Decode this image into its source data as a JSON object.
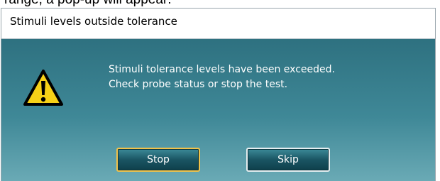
{
  "caption": "range, a pop-up will appear:",
  "dialog": {
    "title": "Stimuli levels outside tolerance",
    "icon": "warning-icon",
    "message_line1": "Stimuli tolerance levels have been exceeded.",
    "message_line2": "Check probe status or stop the test.",
    "buttons": {
      "stop_label": "Stop",
      "skip_label": "Skip"
    }
  },
  "colors": {
    "dialog_background_top": "#2e7180",
    "dialog_background_bottom": "#6aaab5",
    "button_fill": "#1a5563",
    "focus_border": "#f1c24a",
    "warning_yellow": "#f7d117"
  }
}
